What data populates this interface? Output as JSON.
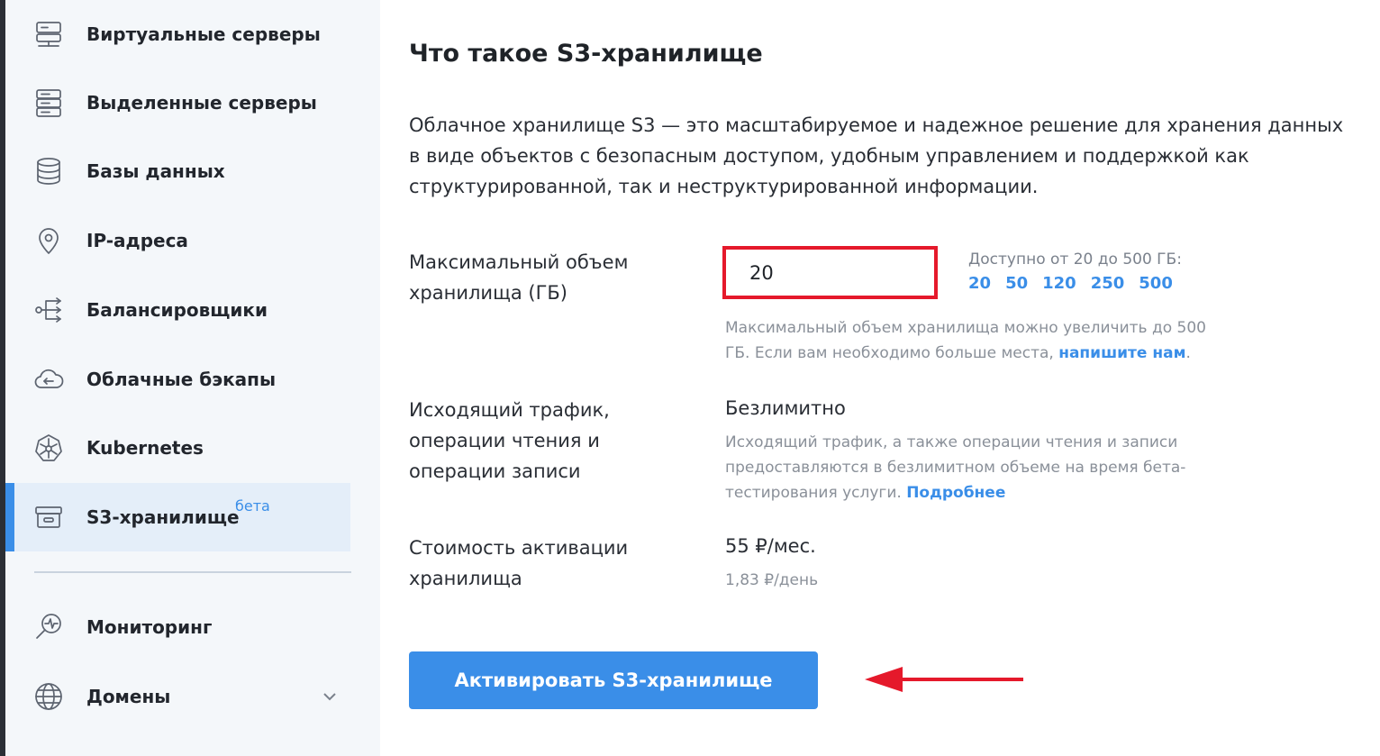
{
  "sidebar": {
    "items": [
      {
        "label": "Виртуальные серверы",
        "icon": "server-stack-icon"
      },
      {
        "label": "Выделенные серверы",
        "icon": "dedicated-server-icon"
      },
      {
        "label": "Базы данных",
        "icon": "database-icon"
      },
      {
        "label": "IP-адреса",
        "icon": "location-pin-icon"
      },
      {
        "label": "Балансировщики",
        "icon": "load-balancer-icon"
      },
      {
        "label": "Облачные бэкапы",
        "icon": "cloud-backup-icon"
      },
      {
        "label": "Kubernetes",
        "icon": "kubernetes-icon"
      },
      {
        "label": "S3-хранилище",
        "icon": "storage-box-icon",
        "badge": "бета",
        "active": true
      },
      {
        "label": "Мониторинг",
        "icon": "monitoring-icon"
      },
      {
        "label": "Домены",
        "icon": "globe-icon",
        "expandable": true
      }
    ]
  },
  "main": {
    "title": "Что такое S3-хранилище",
    "description": "Облачное хранилище S3 — это масштабируемое и надежное решение для хранения данных в виде объектов с безопасным доступом, удобным управлением и поддержкой как структурированной, так и неструктурированной информации.",
    "storage": {
      "label": "Максимальный объем хранилища (ГБ)",
      "value": "20",
      "available_text": "Доступно от 20 до 500 ГБ:",
      "presets": [
        "20",
        "50",
        "120",
        "250",
        "500"
      ],
      "hint": "Максимальный объем хранилища можно увеличить до 500 ГБ. Если вам необходимо больше места, ",
      "hint_link": "напишите нам",
      "hint_end": "."
    },
    "traffic": {
      "label": "Исходящий трафик, операции чтения и операции записи",
      "value": "Безлимитно",
      "hint": "Исходящий трафик, а также операции чтения и записи предоставляются в безлимитном объеме на время бета-тестирования услуги. ",
      "hint_link": "Подробнее"
    },
    "cost": {
      "label": "Стоимость активации хранилища",
      "value": "55 ₽/мес.",
      "per_day": "1,83 ₽/день"
    },
    "activate_button": "Активировать S3-хранилище"
  },
  "colors": {
    "accent": "#3a8ee8",
    "highlight": "#e5192b",
    "sidebar_bg": "#f4f7fa"
  }
}
